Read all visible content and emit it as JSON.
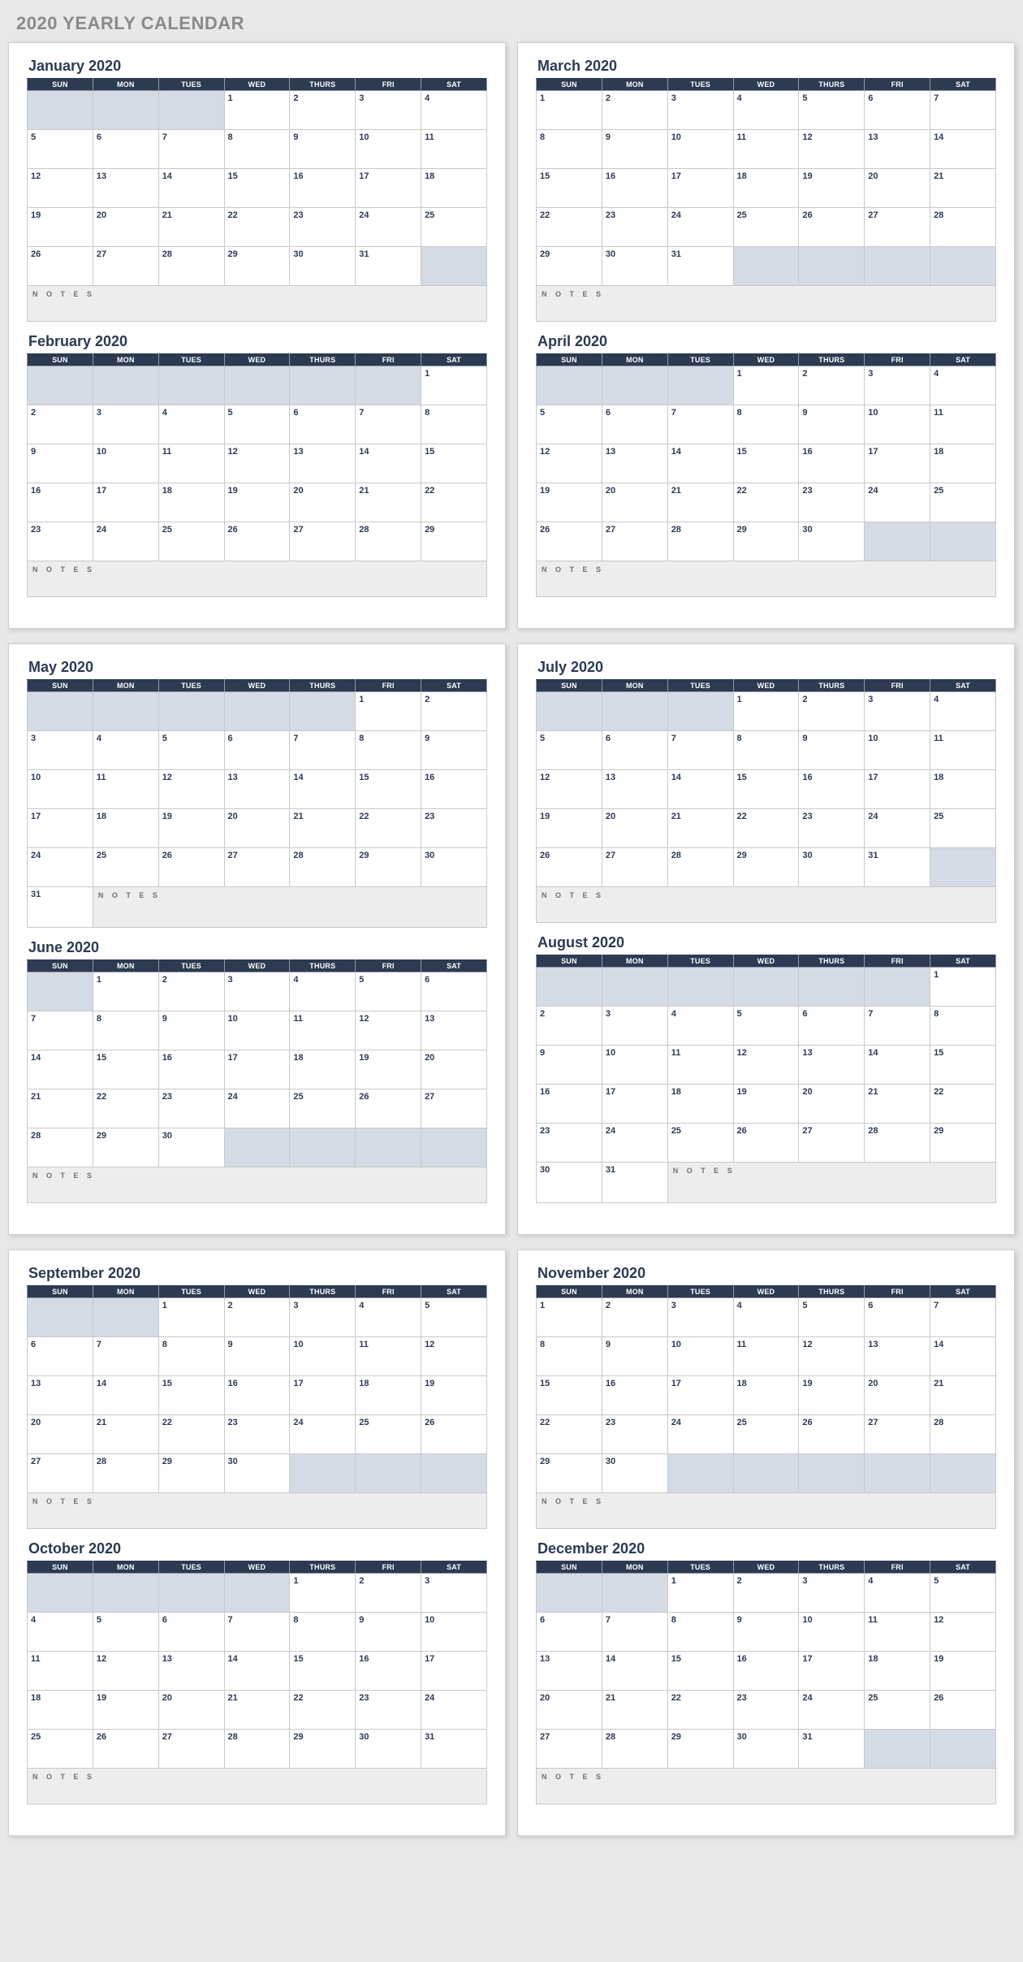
{
  "title": "2020 YEARLY CALENDAR",
  "dayHeaders": [
    "SUN",
    "MON",
    "TUES",
    "WED",
    "THURS",
    "FRI",
    "SAT"
  ],
  "notesLabel": "N O T E S",
  "months": {
    "jan": {
      "title": "January 2020",
      "lead": 3,
      "days": 31,
      "notesStyle": "fullrow"
    },
    "feb": {
      "title": "February 2020",
      "lead": 6,
      "days": 29,
      "notesStyle": "fullrow"
    },
    "mar": {
      "title": "March 2020",
      "lead": 0,
      "days": 31,
      "notesStyle": "fullrow"
    },
    "apr": {
      "title": "April 2020",
      "lead": 3,
      "days": 30,
      "notesStyle": "fullrow"
    },
    "may": {
      "title": "May 2020",
      "lead": 5,
      "days": 31,
      "notesStyle": "merged",
      "notesSpan": 6
    },
    "jun": {
      "title": "June 2020",
      "lead": 1,
      "days": 30,
      "notesStyle": "fullrow"
    },
    "jul": {
      "title": "July 2020",
      "lead": 3,
      "days": 31,
      "notesStyle": "fullrow"
    },
    "aug": {
      "title": "August 2020",
      "lead": 6,
      "days": 31,
      "notesStyle": "merged",
      "notesSpan": 5
    },
    "sep": {
      "title": "September 2020",
      "lead": 2,
      "days": 30,
      "notesStyle": "fullrow"
    },
    "oct": {
      "title": "October 2020",
      "lead": 4,
      "days": 31,
      "notesStyle": "fullrow"
    },
    "nov": {
      "title": "November 2020",
      "lead": 0,
      "days": 30,
      "notesStyle": "fullrow"
    },
    "dec": {
      "title": "December 2020",
      "lead": 2,
      "days": 31,
      "notesStyle": "fullrow"
    }
  },
  "layout": [
    [
      "jan",
      "feb",
      "mar",
      "apr"
    ],
    [
      "may",
      "jun",
      "jul",
      "aug"
    ],
    [
      "sep",
      "oct",
      "nov",
      "dec"
    ]
  ]
}
